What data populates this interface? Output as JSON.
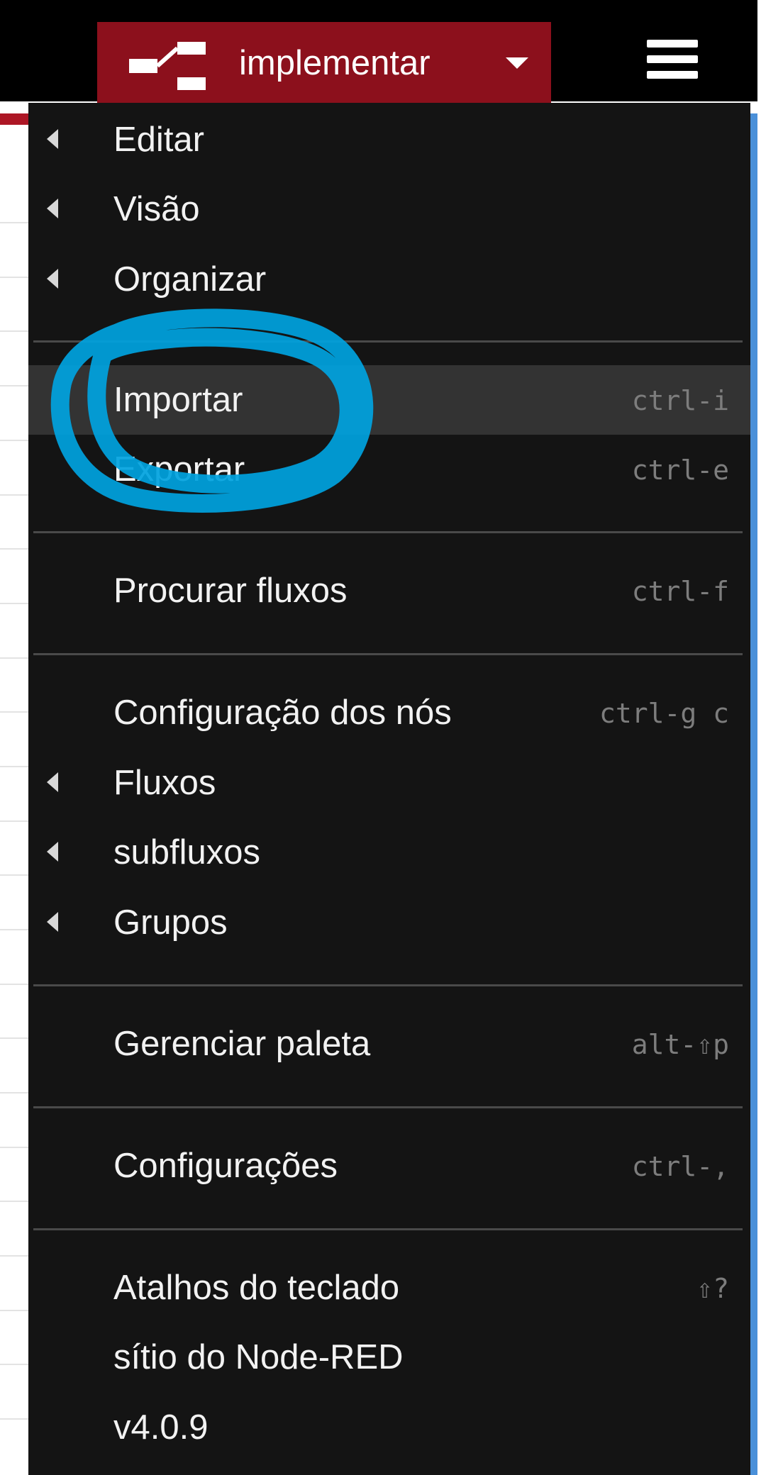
{
  "header": {
    "deploy_label": "implementar",
    "deploy_icon": "deploy-icon",
    "menu_icon": "hamburger-icon"
  },
  "menu": {
    "items": [
      {
        "label": "Editar",
        "submenu": true,
        "shortcut": ""
      },
      {
        "label": "Visão",
        "submenu": true,
        "shortcut": ""
      },
      {
        "label": "Organizar",
        "submenu": true,
        "shortcut": ""
      },
      {
        "label": "Importar",
        "submenu": false,
        "shortcut": "ctrl-i",
        "active": true
      },
      {
        "label": "Exportar",
        "submenu": false,
        "shortcut": "ctrl-e"
      },
      {
        "label": "Procurar fluxos",
        "submenu": false,
        "shortcut": "ctrl-f"
      },
      {
        "label": "Configuração dos nós",
        "submenu": false,
        "shortcut": "ctrl-g c"
      },
      {
        "label": "Fluxos",
        "submenu": true,
        "shortcut": ""
      },
      {
        "label": "subfluxos",
        "submenu": true,
        "shortcut": ""
      },
      {
        "label": "Grupos",
        "submenu": true,
        "shortcut": ""
      },
      {
        "label": "Gerenciar paleta",
        "submenu": false,
        "shortcut": "alt-⇧p"
      },
      {
        "label": "Configurações",
        "submenu": false,
        "shortcut": "ctrl-,"
      },
      {
        "label": "Atalhos do teclado",
        "submenu": false,
        "shortcut": "⇧?"
      },
      {
        "label": "sítio do Node-RED",
        "submenu": false,
        "shortcut": ""
      },
      {
        "label": "v4.0.9",
        "submenu": false,
        "shortcut": ""
      }
    ]
  },
  "colors": {
    "header_bg": "#000000",
    "deploy_bg": "#8c101c",
    "menu_bg": "#141414",
    "active_bg": "#333333",
    "annotation": "#00a3e0"
  }
}
